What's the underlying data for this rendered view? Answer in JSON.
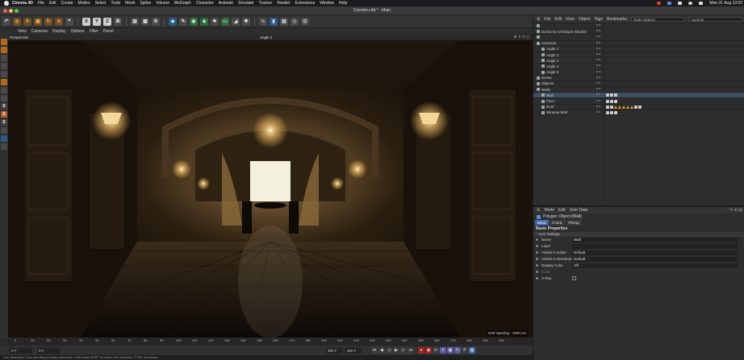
{
  "menubar": {
    "app": "Cinema 4D",
    "items": [
      "File",
      "Edit",
      "Create",
      "Modes",
      "Select",
      "Tools",
      "Mesh",
      "Spline",
      "Volume",
      "MoGraph",
      "Character",
      "Animate",
      "Simulate",
      "Tracker",
      "Render",
      "Extensions",
      "Window",
      "Help"
    ],
    "datetime": "Mon 31 Aug 13:02"
  },
  "window": {
    "title": "Corridor.c4d * - Main"
  },
  "toolbar": {
    "icons": [
      "undo-icon",
      "move-icon",
      "scale-icon",
      "rotate-icon",
      "select-icon",
      "snap-icon"
    ],
    "axis": [
      "X",
      "Y",
      "Z"
    ]
  },
  "viewport_menu": [
    "View",
    "Cameras",
    "Display",
    "Options",
    "Filter",
    "Panel"
  ],
  "viewport": {
    "label": "Perspective",
    "camera": "Angle 2",
    "grid_spacing": "Grid Spacing : 1000 cm"
  },
  "timeline": {
    "ticks": [
      "0",
      "10",
      "20",
      "30",
      "40",
      "50",
      "60",
      "70",
      "80",
      "90",
      "100",
      "110",
      "120",
      "130",
      "140",
      "150",
      "160",
      "170",
      "180",
      "190",
      "200",
      "210",
      "220",
      "230",
      "240",
      "250",
      "260",
      "270",
      "280",
      "290",
      "300"
    ],
    "current_frame": "0 F",
    "start": "0 F",
    "end_a": "300 F",
    "end_b": "300 F"
  },
  "status_text": "Live Selection: Click and drag to select elements. Hold down SHIFT to add to the selection, CTRL to remove.",
  "object_manager": {
    "menu": [
      "File",
      "Edit",
      "View",
      "Object",
      "Tags",
      "Bookmarks"
    ],
    "node_space": "Node Spaces",
    "layout": "Layouts",
    "rows": [
      {
        "name": "",
        "indent": 0
      },
      {
        "name": "Scene by Christoph Gtschel",
        "indent": 0
      },
      {
        "name": "",
        "indent": 0
      },
      {
        "name": "Cameras",
        "indent": 0
      },
      {
        "name": "Angle 1",
        "indent": 1
      },
      {
        "name": "Angle 2",
        "indent": 1
      },
      {
        "name": "Angle 3",
        "indent": 1
      },
      {
        "name": "Angle 4",
        "indent": 1
      },
      {
        "name": "Angle 5",
        "indent": 1
      },
      {
        "name": "Scene",
        "indent": 0
      },
      {
        "name": "Objects",
        "indent": 0
      },
      {
        "name": "Walls",
        "indent": 0
      },
      {
        "name": "Wall",
        "indent": 1
      },
      {
        "name": "Floor",
        "indent": 1
      },
      {
        "name": "Roof",
        "indent": 1
      },
      {
        "name": "Window Wall",
        "indent": 1
      }
    ]
  },
  "attributes": {
    "menu": [
      "Mode",
      "Edit",
      "User Data"
    ],
    "object_type": "Polygon Object [Wall]",
    "tabs": [
      "Basic",
      "Coord.",
      "Phong"
    ],
    "section": "Basic Properties",
    "subsection": "Icon Settings",
    "props": [
      {
        "label": "Name",
        "value": "Wall"
      },
      {
        "label": "Layer",
        "value": ""
      },
      {
        "label": "Visible in Editor",
        "value": "Default"
      },
      {
        "label": "Visible in Renderer",
        "value": "Default"
      },
      {
        "label": "Display Color",
        "value": "Off"
      },
      {
        "label": "Color",
        "value": ""
      },
      {
        "label": "X-Ray",
        "value": ""
      }
    ]
  },
  "colors": {
    "accent": "#3d6aa8",
    "selected_row": "#3f4f62",
    "orange": "#e0a020"
  }
}
